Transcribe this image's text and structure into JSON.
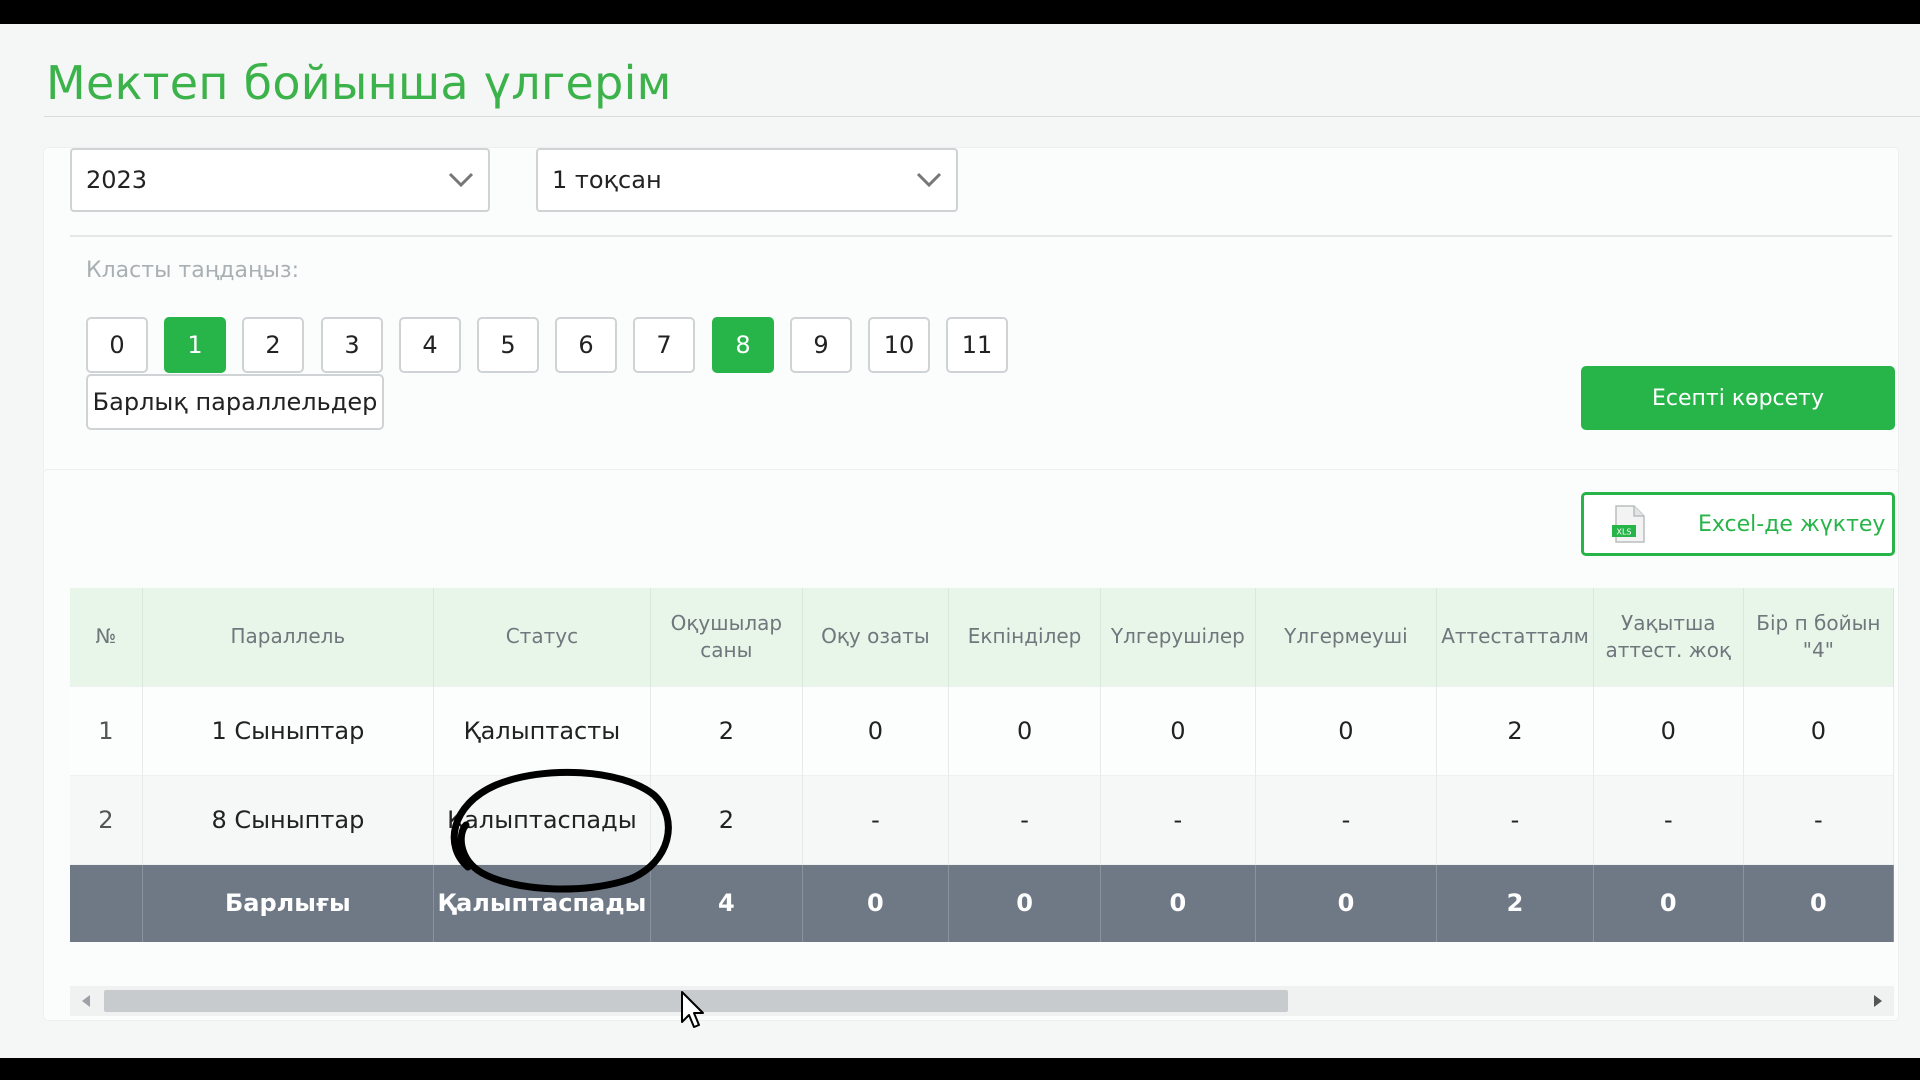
{
  "page": {
    "title": "Мектеп бойынша үлгерім"
  },
  "filters": {
    "year": {
      "value": "2023",
      "icon": "chevron-down-icon"
    },
    "quarter": {
      "value": "1 тоқсан",
      "icon": "chevron-down-icon"
    },
    "class_label": "Класты таңдаңыз:",
    "classes": [
      "0",
      "1",
      "2",
      "3",
      "4",
      "5",
      "6",
      "7",
      "8",
      "9",
      "10",
      "11"
    ],
    "selected_classes": [
      "1",
      "8"
    ],
    "all_parallels_label": "Барлық параллельдер",
    "show_report_label": "Есепті көрсету"
  },
  "results": {
    "excel_label": "Excel-де жүктеу",
    "excel_icon": "xls-file-icon",
    "columns": [
      "№",
      "Параллель",
      "Статус",
      "Оқушылар саны",
      "Оқу озаты",
      "Екпінділер",
      "Үлгерушілер",
      "Үлгермеуші",
      "Аттестатталм",
      "Уақытша аттест. жоқ",
      "Бір п бойын \"4\""
    ],
    "rows": [
      [
        "1",
        "1 Сыныптар",
        "Қалыптасты",
        "2",
        "0",
        "0",
        "0",
        "0",
        "2",
        "0",
        "0"
      ],
      [
        "2",
        "8 Сыныптар",
        "Қалыптаспады",
        "2",
        "-",
        "-",
        "-",
        "-",
        "-",
        "-",
        "-"
      ]
    ],
    "total_row": [
      "",
      "Барлығы",
      "Қалыптаспады",
      "4",
      "0",
      "0",
      "0",
      "0",
      "2",
      "0",
      "0"
    ]
  },
  "colors": {
    "accent_green": "#27b54a",
    "title_green": "#3cb34a",
    "header_bg": "#e8f6ea",
    "total_row_bg": "#6f7985"
  }
}
